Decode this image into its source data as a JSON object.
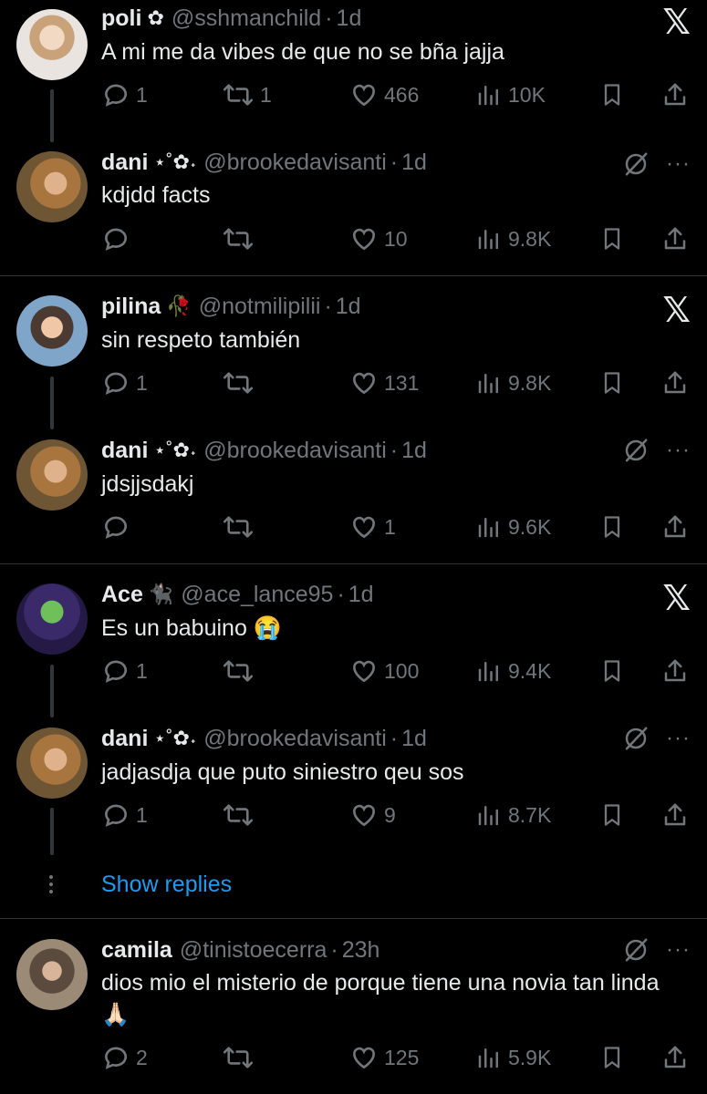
{
  "tweets": [
    {
      "name": "poli",
      "deco": "✿",
      "handle": "@sshmanchild",
      "time": "1d",
      "text": "A mi me da vibes de que no se bña jajja",
      "replies": "1",
      "retweets": "1",
      "likes": "466",
      "views": "10K",
      "corner": "X"
    },
    {
      "name": "dani",
      "deco": "⋆˚✿˖",
      "handle": "@brookedavisanti",
      "time": "1d",
      "text": "kdjdd facts",
      "replies": "",
      "retweets": "",
      "likes": "10",
      "views": "9.8K",
      "corner": "grok"
    },
    {
      "name": "pilina",
      "deco": "🥀",
      "handle": "@notmilipilii",
      "time": "1d",
      "text": "sin respeto también",
      "replies": "1",
      "retweets": "",
      "likes": "131",
      "views": "9.8K",
      "corner": "X"
    },
    {
      "name": "dani",
      "deco": "⋆˚✿˖",
      "handle": "@brookedavisanti",
      "time": "1d",
      "text": "jdsjjsdakj",
      "replies": "",
      "retweets": "",
      "likes": "1",
      "views": "9.6K",
      "corner": "grok"
    },
    {
      "name": "Ace",
      "deco": "🐈‍⬛",
      "handle": "@ace_lance95",
      "time": "1d",
      "text": "Es un babuino 😭",
      "replies": "1",
      "retweets": "",
      "likes": "100",
      "views": "9.4K",
      "corner": "X"
    },
    {
      "name": "dani",
      "deco": "⋆˚✿˖",
      "handle": "@brookedavisanti",
      "time": "1d",
      "text": "jadjasdja que puto siniestro qeu sos",
      "replies": "1",
      "retweets": "",
      "likes": "9",
      "views": "8.7K",
      "corner": "grok"
    },
    {
      "name": "camila",
      "deco": "",
      "handle": "@tinistoecerra",
      "time": "23h",
      "text": "dios mio el misterio de porque tiene una novia tan linda🙏🏻",
      "replies": "2",
      "retweets": "",
      "likes": "125",
      "views": "5.9K",
      "corner": "grok"
    }
  ],
  "show_replies": "Show replies",
  "separator_dot": "·",
  "x_logo": "𝕏",
  "more_label": "···",
  "colors": {
    "background": "#000000",
    "text": "#e7e9ea",
    "muted": "#71767b",
    "link": "#1d9bf0"
  },
  "icons": [
    "reply-icon",
    "retweet-icon",
    "like-icon",
    "views-icon",
    "bookmark-icon",
    "share-icon",
    "grok-icon",
    "more-icon",
    "x-logo-icon"
  ]
}
